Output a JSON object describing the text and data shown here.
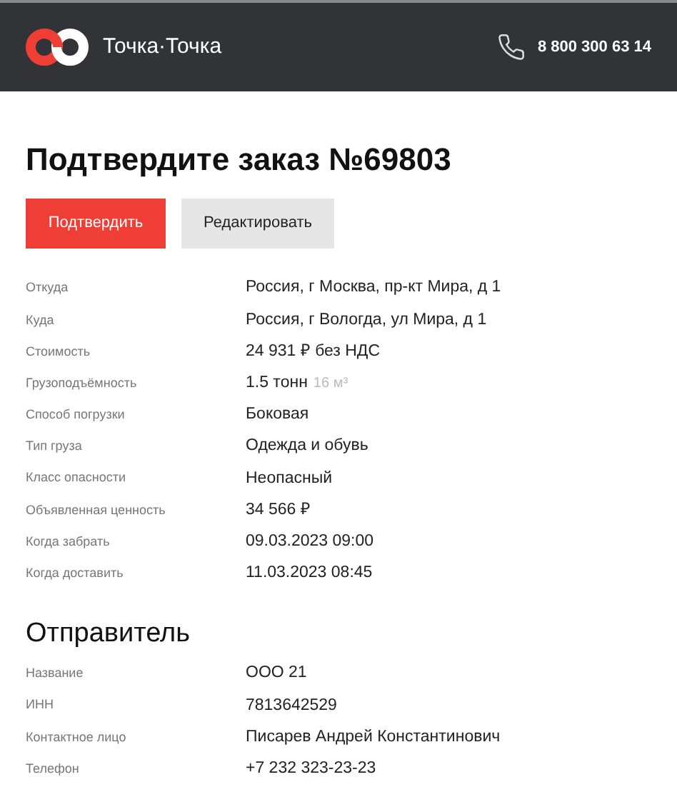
{
  "header": {
    "logo_text": "Точка·Точка",
    "phone": "8 800 300 63 14"
  },
  "title": "Подтвердите заказ №69803",
  "buttons": [
    {
      "label": "Подтвердить",
      "kind": "primary"
    },
    {
      "label": "Редактировать",
      "kind": "secondary"
    }
  ],
  "details": [
    {
      "label": "Откуда",
      "value": "Россия, г Москва, пр-кт Мира, д 1"
    },
    {
      "label": "Куда",
      "value": "Россия, г Вологда, ул Мира, д 1"
    },
    {
      "label": "Стоимость",
      "value": "24 931 ₽ без НДС"
    },
    {
      "label": "Грузоподъёмность",
      "value": "1.5 тонн",
      "note": "16 м³"
    },
    {
      "label": "Способ погрузки",
      "value": "Боковая"
    },
    {
      "label": "Тип груза",
      "value": "Одежда и обувь"
    },
    {
      "label": "Класс опасности",
      "value": "Неопасный"
    },
    {
      "label": "Объявленная ценность",
      "value": "34 566 ₽"
    },
    {
      "label": "Когда забрать",
      "value": "09.03.2023 09:00"
    },
    {
      "label": "Когда доставить",
      "value": "11.03.2023 08:45"
    }
  ],
  "sender": {
    "title": "Отправитель",
    "rows": [
      {
        "label": "Название",
        "value": "ООО 21"
      },
      {
        "label": "ИНН",
        "value": "7813642529"
      },
      {
        "label": "Контактное лицо",
        "value": "Писарев Андрей Константинович"
      },
      {
        "label": "Телефон",
        "value": "+7 232 323-23-23"
      }
    ]
  }
}
